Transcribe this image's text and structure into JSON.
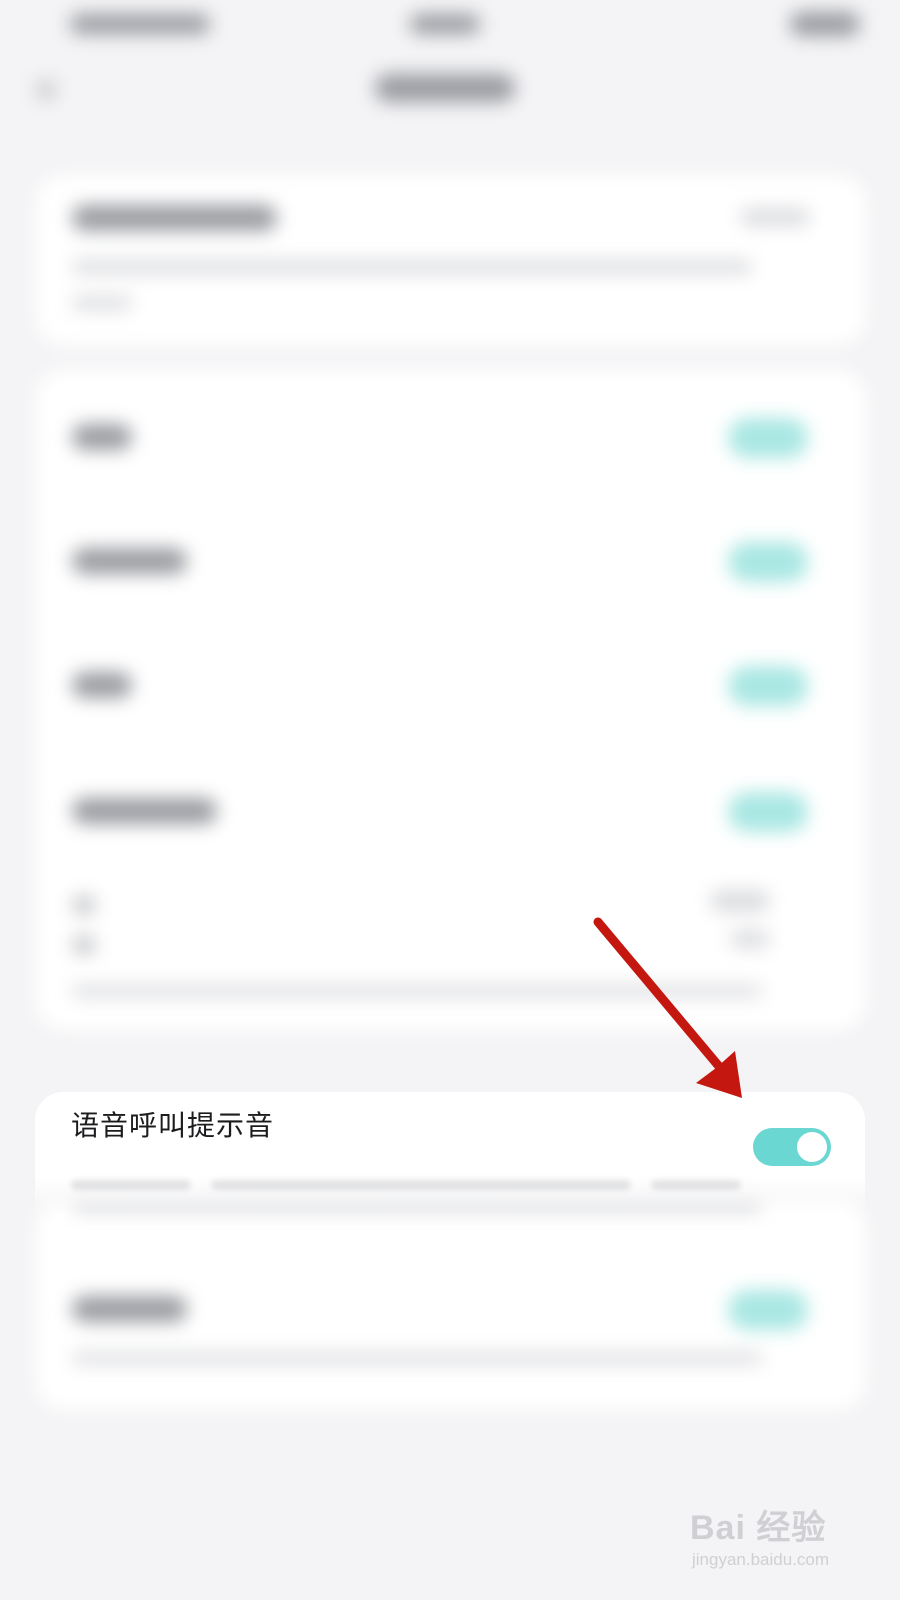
{
  "setting": {
    "label": "语音呼叫提示音",
    "enabled": true
  },
  "colors": {
    "toggle_on": "#6ad7d3",
    "arrow": "#c4170f",
    "background": "#f4f4f6"
  },
  "icons": {
    "annotation": "red-arrow-icon",
    "toggle_knob": "toggle-knob-icon"
  },
  "watermark": {
    "brand": "Bai  经验",
    "site": "jingyan.baidu.com"
  }
}
